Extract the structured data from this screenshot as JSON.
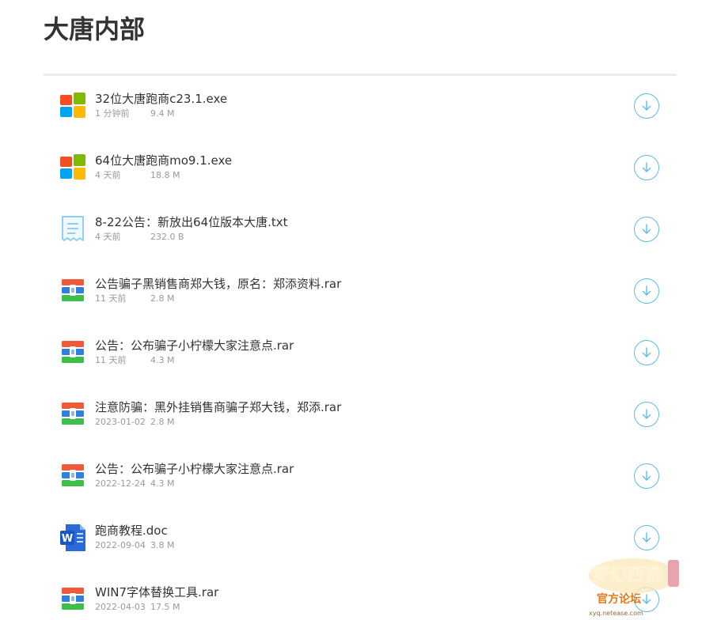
{
  "page": {
    "title": "大唐内部"
  },
  "files": [
    {
      "name": "32位大唐跑商c23.1.exe",
      "date": "1 分钟前",
      "size": "9.4 M",
      "icon": "windows-icon"
    },
    {
      "name": "64位大唐跑商mo9.1.exe",
      "date": "4 天前",
      "size": "18.8 M",
      "icon": "windows-icon"
    },
    {
      "name": "8-22公告：新放出64位版本大唐.txt",
      "date": "4 天前",
      "size": "232.0 B",
      "icon": "text-file-icon"
    },
    {
      "name": "公告骗子黑销售商郑大钱，原名：郑添资料.rar",
      "date": "11 天前",
      "size": "2.8 M",
      "icon": "archive-icon"
    },
    {
      "name": "公告：公布骗子小柠檬大家注意点.rar",
      "date": "11 天前",
      "size": "4.3 M",
      "icon": "archive-icon"
    },
    {
      "name": "注意防骗：黑外挂销售商骗子郑大钱，郑添.rar",
      "date": "2023-01-02",
      "size": "2.8 M",
      "icon": "archive-icon"
    },
    {
      "name": "公告：公布骗子小柠檬大家注意点.rar",
      "date": "2022-12-24",
      "size": "4.3 M",
      "icon": "archive-icon"
    },
    {
      "name": "跑商教程.doc",
      "date": "2022-09-04",
      "size": "3.8 M",
      "icon": "word-doc-icon"
    },
    {
      "name": "WIN7字体替换工具.rar",
      "date": "2022-04-03",
      "size": "17.5 M",
      "icon": "archive-icon"
    }
  ],
  "watermark": {
    "logo_text": "梦幻西游",
    "sub_text": "官方论坛",
    "url_text": "xyq.netease.com"
  },
  "colors": {
    "accent": "#5dbbe8",
    "title": "#333333",
    "meta": "#9a9a9a",
    "divider": "#ececec"
  }
}
